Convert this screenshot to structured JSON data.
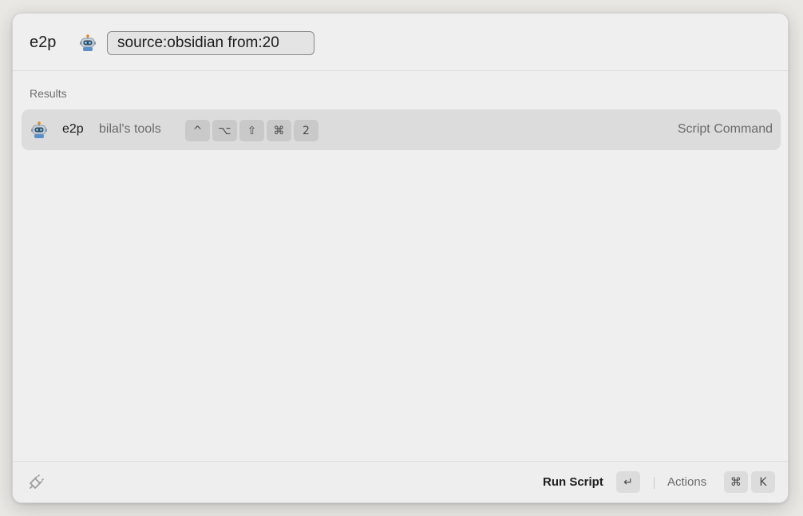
{
  "search": {
    "command_name": "e2p",
    "command_icon": "robot-icon",
    "argument_value": "source:obsidian from:20"
  },
  "results": {
    "section_label": "Results",
    "items": [
      {
        "icon": "robot-icon",
        "title": "e2p",
        "subtitle": "bilal's tools",
        "hotkey": [
          "^",
          "⌥",
          "⇧",
          "⌘",
          "2"
        ],
        "type": "Script Command"
      }
    ]
  },
  "footer": {
    "icon": "extension-icon",
    "primary_action_label": "Run Script",
    "primary_action_key": "↵",
    "actions_label": "Actions",
    "actions_keys": [
      "⌘",
      "K"
    ]
  }
}
